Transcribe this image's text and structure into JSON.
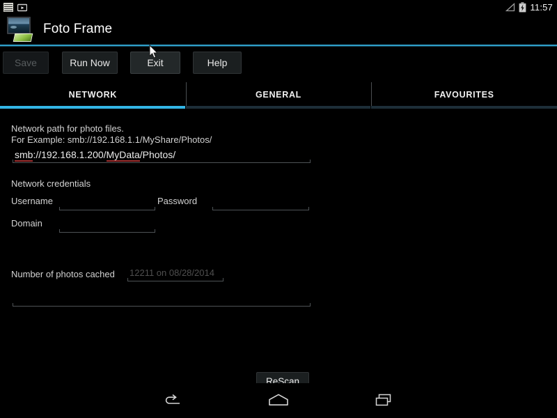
{
  "statusbar": {
    "left_icons": [
      "news-app-icon",
      "video-play-icon"
    ],
    "right_icons": [
      "signal-triangle-icon",
      "battery-charging-icon"
    ],
    "clock": "11:57"
  },
  "appbar": {
    "icon": "foto-frame-app-icon",
    "title": "Foto Frame",
    "accent_color": "#33b5e5"
  },
  "toolbar": {
    "save_label": "Save",
    "run_now_label": "Run Now",
    "exit_label": "Exit",
    "help_label": "Help",
    "save_enabled": false,
    "exit_hovered": true
  },
  "tabs": {
    "items": [
      {
        "label": "NETWORK",
        "active": true
      },
      {
        "label": "GENERAL",
        "active": false
      },
      {
        "label": "FAVOURITES",
        "active": false
      }
    ],
    "active_index": 0,
    "indicator_color": "#33b5e5"
  },
  "network_tab": {
    "path_heading": "Network path for photo files.",
    "path_example": "For Example:  smb://192.168.1.1/MyShare/Photos/",
    "path_value_parts": {
      "misspelled_1": "smb",
      "mid_1": "://192.168.1.200/",
      "misspelled_2": "MyData",
      "tail": "/Photos/"
    },
    "path_value": "smb://192.168.1.200/MyData/Photos/",
    "credentials_heading": "Network credentials",
    "username_label": "Username",
    "username_value": "",
    "password_label": "Password",
    "password_value": "",
    "domain_label": "Domain",
    "domain_value": "",
    "cached_label": "Number of photos cached",
    "cached_value": "12211 on 08/28/2014",
    "rescan_label": "ReScan",
    "bottom_field_value": ""
  },
  "navbar": {
    "back": "back-icon",
    "home": "home-icon",
    "recents": "recents-icon"
  }
}
